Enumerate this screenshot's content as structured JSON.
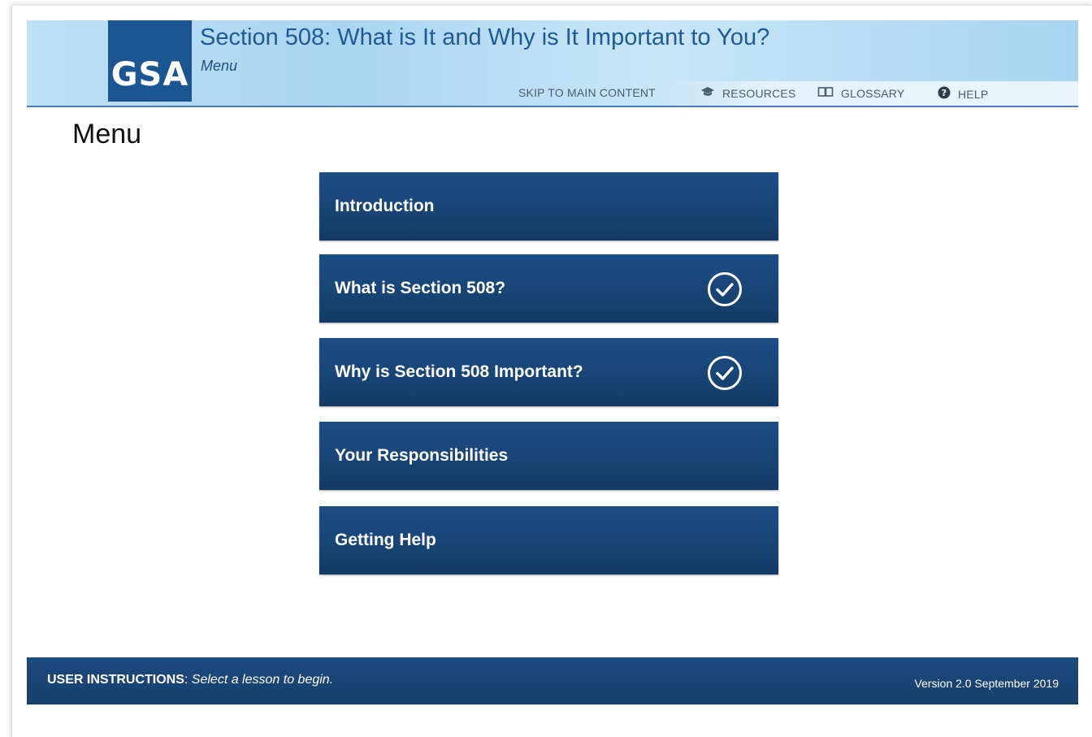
{
  "header": {
    "logo_text": "GSA",
    "title": "Section 508: What is It and Why is It Important to You?",
    "subtitle": "Menu",
    "nav": {
      "skip": "SKIP TO MAIN CONTENT",
      "resources": "RESOURCES",
      "glossary": "GLOSSARY",
      "help": "HELP"
    }
  },
  "page": {
    "heading": "Menu"
  },
  "menu": {
    "items": [
      {
        "label": "Introduction",
        "completed": false
      },
      {
        "label": "What is Section 508?",
        "completed": true
      },
      {
        "label": "Why is Section 508 Important?",
        "completed": true
      },
      {
        "label": "Your Responsibilities",
        "completed": false
      },
      {
        "label": "Getting Help",
        "completed": false
      }
    ]
  },
  "footer": {
    "instructions_label": "USER INSTRUCTIONS",
    "instructions_text": "Select a lesson to begin.",
    "version": "Version 2.0 September 2019"
  },
  "colors": {
    "brand_blue": "#1b5692",
    "button_blue": "#184575",
    "header_sky": "#bfe0f5"
  },
  "icons": {
    "resources": "graduation-cap-icon",
    "glossary": "open-book-icon",
    "help": "question-circle-icon",
    "completed": "checkmark-circle-icon"
  }
}
